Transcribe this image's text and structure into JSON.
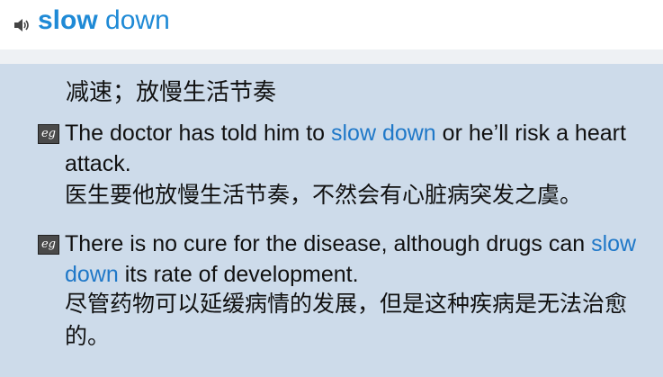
{
  "header": {
    "speaker_icon": "speaker-icon",
    "headword_part1": "slow",
    "headword_part2": "down"
  },
  "meaning": "减速；放慢生活节奏",
  "examples": [
    {
      "icon": "eg-icon",
      "en_before": "The doctor has told him to ",
      "en_highlight": "slow down",
      "en_after": " or he’ll risk a heart attack.",
      "zh": "医生要他放慢生活节奏，不然会有心脏病突发之虞。"
    },
    {
      "icon": "eg-icon",
      "en_before": "There is no cure for the disease, although drugs can ",
      "en_highlight": "slow down",
      "en_after": " its rate of development.",
      "zh": "尽管药物可以延缓病情的发展，但是这种疾病是无法治愈的。"
    }
  ],
  "colors": {
    "headword": "#1f8ad6",
    "highlight": "#1f78c8",
    "panel": "#cddbea"
  }
}
